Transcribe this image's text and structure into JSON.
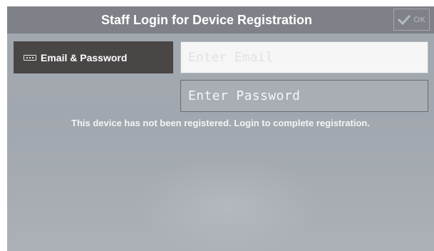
{
  "header": {
    "title": "Staff Login for Device Registration",
    "ok_label": "OK",
    "ok_icon": "check-icon"
  },
  "login_tabs": [
    {
      "label": "Email & Password",
      "icon": "keyboard-icon",
      "selected": true
    }
  ],
  "fields": {
    "email": {
      "value": "",
      "placeholder": "Enter Email"
    },
    "password": {
      "value": "",
      "placeholder": "Enter Password"
    }
  },
  "status_message": "This device has not been registered. Login to complete registration.",
  "colors": {
    "background": "#a3a9b0",
    "title_bar": "#7e8288",
    "selected_tab": "#4a4646",
    "email_field": "#f6f6f6",
    "text": "#ffffff"
  }
}
